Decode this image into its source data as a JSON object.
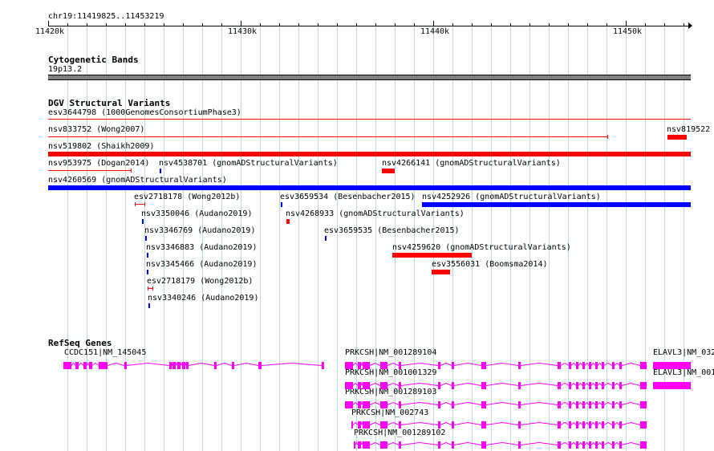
{
  "ruler": {
    "coords": "chr19:11419825..11453219",
    "ticks": [
      "11420k",
      "11430k",
      "11440k",
      "11450k"
    ]
  },
  "cytoband": {
    "title": "Cytogenetic Bands",
    "band": "19p13.2"
  },
  "dgv": {
    "title": "DGV Structural Variants",
    "labels": [
      "esv3644798 (1000GenomesConsortiumPhase3)",
      "nsv833752 (Wong2007)",
      "nsv819522",
      "nsv519802 (Shaikh2009)",
      "nsv953975 (Dogan2014)",
      "nsv4538701 (gnomADStructuralVariants)",
      "nsv4266141 (gnomADStructuralVariants)",
      "nsv4260569 (gnomADStructuralVariants)",
      "esv2718178 (Wong2012b)",
      "esv3659534 (Besenbacher2015)",
      "nsv4252926 (gnomADStructuralVariants)",
      "nsv3350046 (Audano2019)",
      "nsv4268933 (gnomADStructuralVariants)",
      "nsv3346769 (Audano2019)",
      "esv3659535 (Besenbacher2015)",
      "nsv3346883 (Audano2019)",
      "nsv4259620 (gnomADStructuralVariants)",
      "nsv3345466 (Audano2019)",
      "esv3556031 (Boomsma2014)",
      "esv2718179 (Wong2012b)",
      "nsv3340246 (Audano2019)"
    ]
  },
  "refseq": {
    "title": "RefSeq Genes",
    "labels": [
      "CCDC151|NM_145045",
      "PRKCSH|NM_001289104",
      "ELAVL3|NM_032",
      "PRKCSH|NM_001001329",
      "ELAVL3|NM_001",
      "PRKCSH|NM_001289103",
      "PRKCSH|NM_002743",
      "PRKCSH|NM_001289102"
    ]
  },
  "colors": {
    "gridline": "#b4dcf0",
    "cytoband": "#808080",
    "loss": "#ff0000",
    "gain": "#0000ff",
    "gene": "#ff00ff"
  }
}
